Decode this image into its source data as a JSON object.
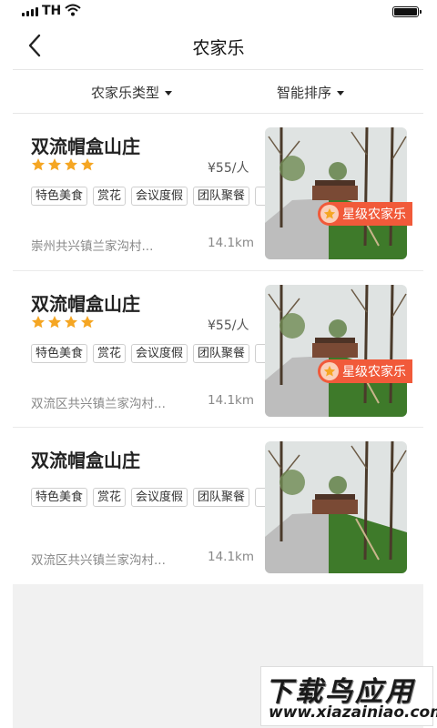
{
  "status_bar": {
    "carrier": "TH"
  },
  "nav": {
    "title": "农家乐"
  },
  "filters": [
    {
      "label": "农家乐类型"
    },
    {
      "label": "智能排序"
    }
  ],
  "listings": [
    {
      "name": "双流帽盒山庄",
      "stars": 4,
      "price": "¥55/人",
      "tags": [
        "特色美食",
        "赏花",
        "会议度假",
        "团队聚餐"
      ],
      "address": "崇州共兴镇兰家沟村...",
      "distance": "14.1km",
      "badge": "星级农家乐"
    },
    {
      "name": "双流帽盒山庄",
      "stars": 4,
      "price": "¥55/人",
      "tags": [
        "特色美食",
        "赏花",
        "会议度假",
        "团队聚餐"
      ],
      "address": "双流区共兴镇兰家沟村...",
      "distance": "14.1km",
      "badge": "星级农家乐"
    },
    {
      "name": "双流帽盒山庄",
      "stars": null,
      "price": null,
      "tags": [
        "特色美食",
        "赏花",
        "会议度假",
        "团队聚餐"
      ],
      "address": "双流区共兴镇兰家沟村...",
      "distance": "14.1km",
      "badge": null
    }
  ],
  "watermark": {
    "title": "下载鸟应用",
    "url": "www.xiazainiao.com"
  },
  "colors": {
    "star": "#f5a623",
    "badge": "#f15a3a",
    "divider": "#e6e6e6",
    "background_gray": "#f1f1f1"
  },
  "icons": [
    "back-arrow-icon",
    "star-icon",
    "caret-down-icon",
    "crown-star-icon",
    "signal-icon",
    "wifi-icon",
    "battery-icon"
  ]
}
